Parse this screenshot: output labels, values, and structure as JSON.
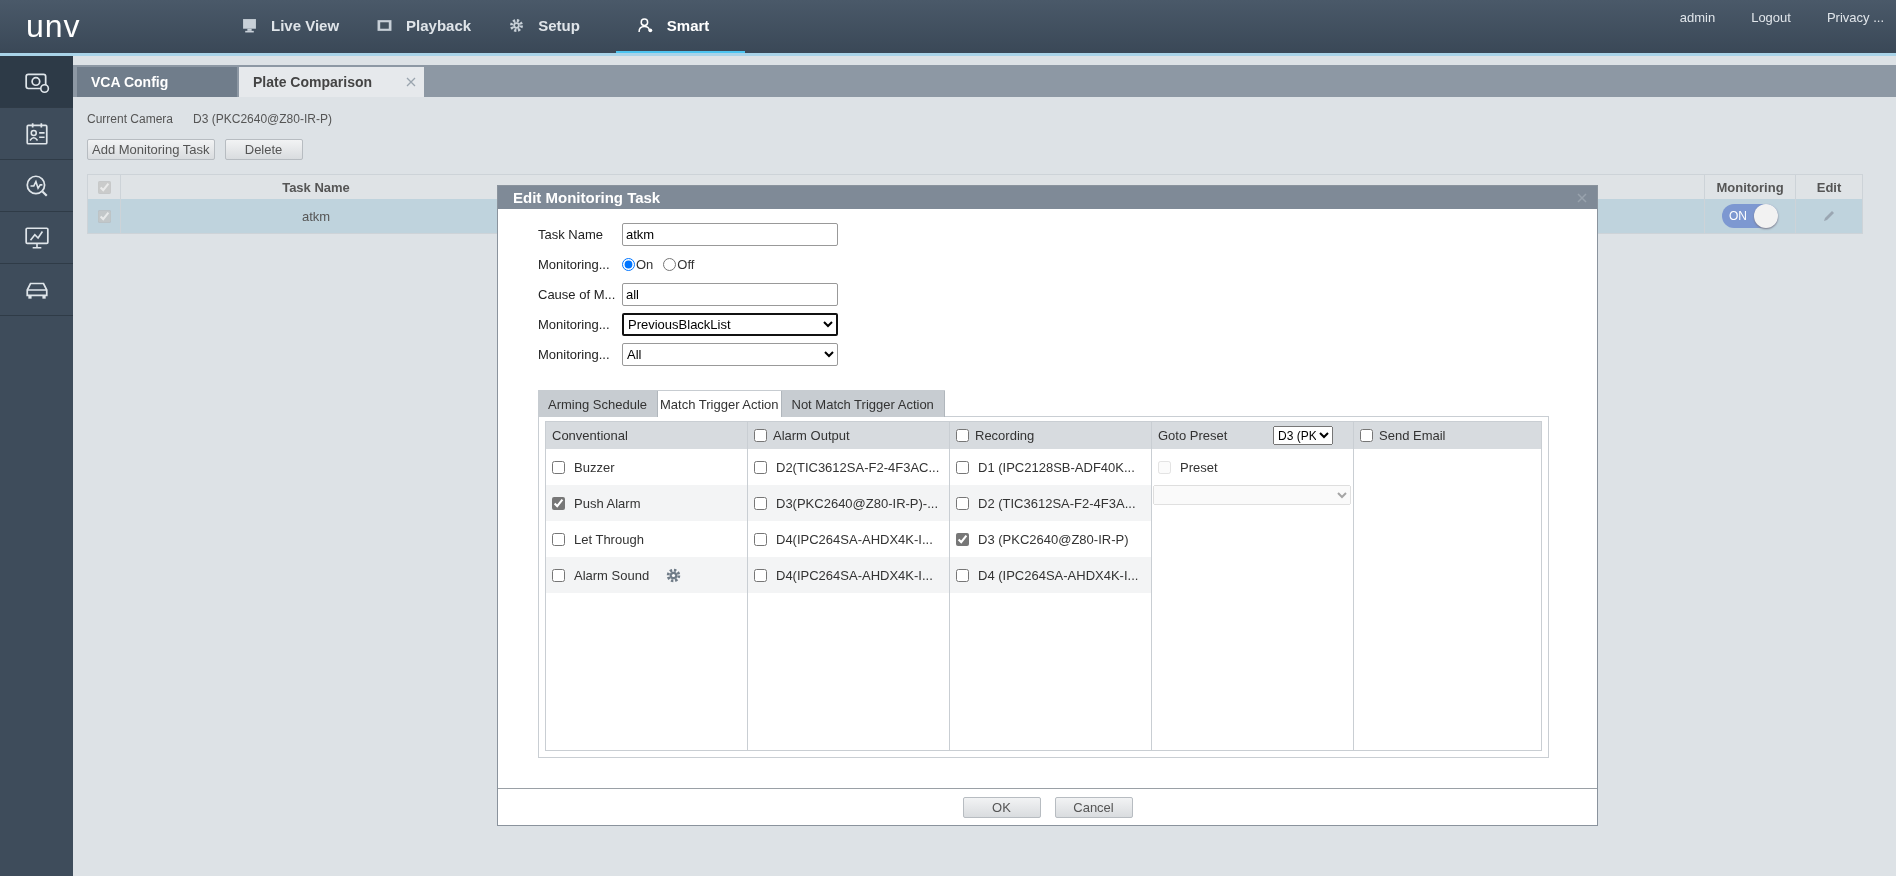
{
  "header": {
    "logo": "unv",
    "nav": [
      {
        "label": "Live View",
        "kind": "monitor",
        "selected": false
      },
      {
        "label": "Playback",
        "kind": "film",
        "selected": false
      },
      {
        "label": "Setup",
        "kind": "gear",
        "selected": false
      },
      {
        "label": "Smart",
        "kind": "person",
        "selected": true
      }
    ],
    "user_links": [
      "admin",
      "Logout",
      "Privacy ..."
    ]
  },
  "sidebar": {
    "items": [
      {
        "kind": "camera-gear",
        "selected": true
      },
      {
        "kind": "id-card",
        "selected": false
      },
      {
        "kind": "chart",
        "selected": false
      },
      {
        "kind": "monitor-chart",
        "selected": false
      },
      {
        "kind": "car",
        "selected": false
      }
    ]
  },
  "page_tabs": [
    {
      "label": "VCA Config",
      "selected": false,
      "closable": false
    },
    {
      "label": "Plate Comparison",
      "selected": true,
      "closable": true
    }
  ],
  "current_camera": {
    "label": "Current Camera",
    "value": "D3 (PKC2640@Z80-IR-P)"
  },
  "buttons": [
    "Add Monitoring Task",
    "Delete"
  ],
  "task_table": {
    "header_checked": true,
    "columns": [
      "Task Name",
      "Monitoring",
      "Edit"
    ],
    "rows": [
      {
        "checked": true,
        "selected": true,
        "task_name": "atkm",
        "monitoring_on": true,
        "switch_text": "ON"
      }
    ]
  },
  "dialog": {
    "title": "Edit Monitoring Task",
    "fields": [
      {
        "kind": "text",
        "label": "Task Name",
        "value": "atkm"
      },
      {
        "kind": "radio",
        "label": "Monitoring...",
        "options": [
          {
            "label": "On",
            "selected": true
          },
          {
            "label": "Off",
            "selected": false
          }
        ]
      },
      {
        "kind": "text",
        "label": "Cause of M...",
        "value": "all"
      },
      {
        "kind": "select",
        "label": "Monitoring...",
        "value": "PreviousBlackList",
        "focused": true
      },
      {
        "kind": "select",
        "label": "Monitoring...",
        "value": "All",
        "focused": false
      }
    ],
    "tabs": [
      {
        "label": "Arming Schedule",
        "selected": false
      },
      {
        "label": "Match Trigger Action",
        "selected": true
      },
      {
        "label": "Not Match Trigger Action",
        "selected": false
      }
    ],
    "action_columns": [
      {
        "kind": "list",
        "title": "Conventional",
        "items": [
          {
            "label": "Buzzer",
            "checked": false,
            "settings": false
          },
          {
            "label": "Push Alarm",
            "checked": true,
            "settings": false
          },
          {
            "label": "Let Through",
            "checked": false,
            "settings": false
          },
          {
            "label": "Alarm Sound",
            "checked": false,
            "settings": true
          }
        ]
      },
      {
        "kind": "list",
        "title": "Alarm Output",
        "checked": false,
        "items": [
          {
            "label": "D2(TIC3612SA-F2-4F3AC...",
            "checked": false,
            "settings": false
          },
          {
            "label": "D3(PKC2640@Z80-IR-P)-...",
            "checked": false,
            "settings": false
          },
          {
            "label": "D4(IPC264SA-AHDX4K-I...",
            "checked": false,
            "settings": false
          },
          {
            "label": "D4(IPC264SA-AHDX4K-I...",
            "checked": false,
            "settings": false
          }
        ]
      },
      {
        "kind": "list",
        "title": "Recording",
        "checked": false,
        "items": [
          {
            "label": "D1 (IPC2128SB-ADF40K...",
            "checked": false,
            "settings": false
          },
          {
            "label": "D2 (TIC3612SA-F2-4F3A...",
            "checked": false,
            "settings": false
          },
          {
            "label": "D3 (PKC2640@Z80-IR-P)",
            "checked": true,
            "settings": false
          },
          {
            "label": "D4 (IPC264SA-AHDX4K-I...",
            "checked": false,
            "settings": false
          }
        ]
      },
      {
        "kind": "preset",
        "title": "Goto Preset",
        "select_value": "D3 (PK",
        "preset_label": "Preset",
        "preset_checked": false
      },
      {
        "kind": "email",
        "title": "Send Email",
        "checked": false
      }
    ]
  },
  "dialog_buttons": [
    "OK",
    "Cancel"
  ]
}
